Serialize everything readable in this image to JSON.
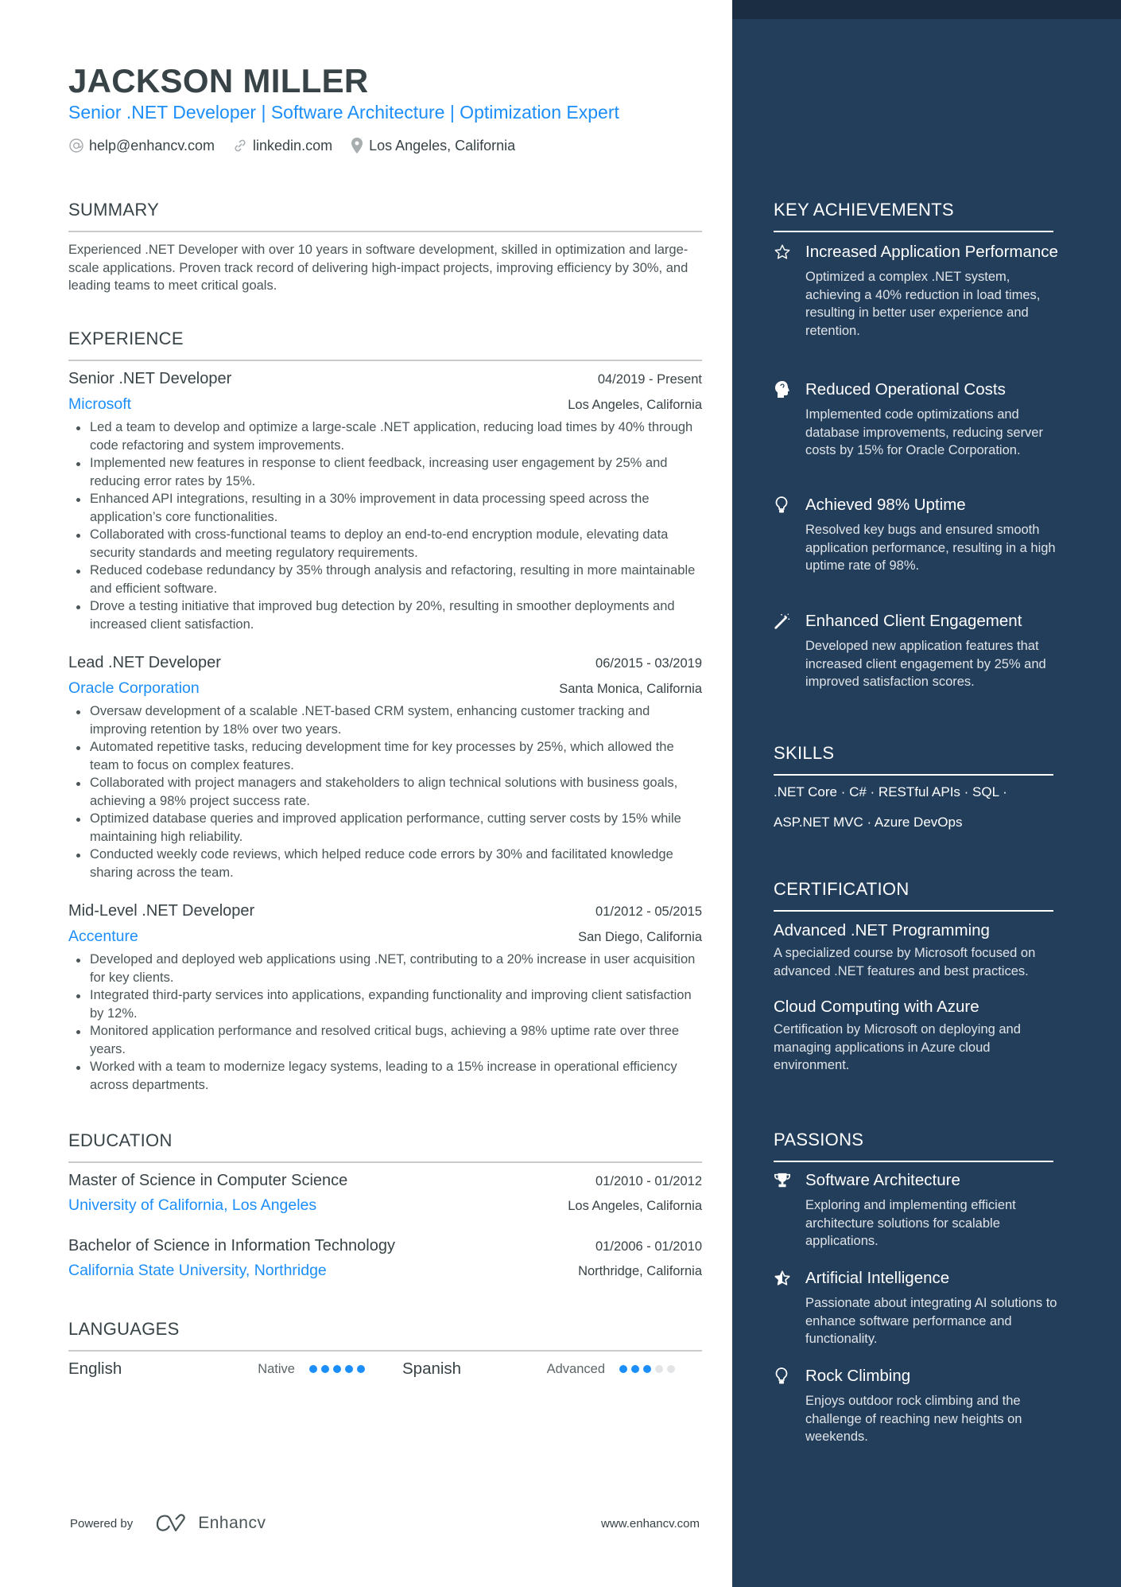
{
  "header": {
    "name": "JACKSON MILLER",
    "title": "Senior .NET Developer | Software Architecture | Optimization Expert",
    "contacts": [
      {
        "icon": "at-icon",
        "label": "help@enhancv.com"
      },
      {
        "icon": "link-icon",
        "label": "linkedin.com"
      },
      {
        "icon": "location-pin-icon",
        "label": "Los Angeles, California"
      }
    ]
  },
  "summary": {
    "heading": "SUMMARY",
    "text": "Experienced .NET Developer with over 10 years in software development, skilled in optimization and large-scale applications. Proven track record of delivering high-impact projects, improving efficiency by 30%, and leading teams to meet critical goals."
  },
  "experience": {
    "heading": "EXPERIENCE",
    "jobs": [
      {
        "role": "Senior .NET Developer",
        "dates": "04/2019 - Present",
        "company": "Microsoft",
        "location": "Los Angeles, California",
        "bullets": [
          "Led a team to develop and optimize a large-scale .NET application, reducing load times by 40% through code refactoring and system improvements.",
          "Implemented new features in response to client feedback, increasing user engagement by 25% and reducing error rates by 15%.",
          "Enhanced API integrations, resulting in a 30% improvement in data processing speed across the application’s core functionalities.",
          "Collaborated with cross-functional teams to deploy an end-to-end encryption module, elevating data security standards and meeting regulatory requirements.",
          "Reduced codebase redundancy by 35% through analysis and refactoring, resulting in more maintainable and efficient software.",
          "Drove a testing initiative that improved bug detection by 20%, resulting in smoother deployments and increased client satisfaction."
        ]
      },
      {
        "role": "Lead .NET Developer",
        "dates": "06/2015 - 03/2019",
        "company": "Oracle Corporation",
        "location": "Santa Monica, California",
        "bullets": [
          "Oversaw development of a scalable .NET-based CRM system, enhancing customer tracking and improving retention by 18% over two years.",
          "Automated repetitive tasks, reducing development time for key processes by 25%, which allowed the team to focus on complex features.",
          "Collaborated with project managers and stakeholders to align technical solutions with business goals, achieving a 98% project success rate.",
          "Optimized database queries and improved application performance, cutting server costs by 15% while maintaining high reliability.",
          "Conducted weekly code reviews, which helped reduce code errors by 30% and facilitated knowledge sharing across the team."
        ]
      },
      {
        "role": "Mid-Level .NET Developer",
        "dates": "01/2012 - 05/2015",
        "company": "Accenture",
        "location": "San Diego, California",
        "bullets": [
          "Developed and deployed web applications using .NET, contributing to a 20% increase in user acquisition for key clients.",
          "Integrated third-party services into applications, expanding functionality and improving client satisfaction by 12%.",
          "Monitored application performance and resolved critical bugs, achieving a 98% uptime rate over three years.",
          "Worked with a team to modernize legacy systems, leading to a 15% increase in operational efficiency across departments."
        ]
      }
    ]
  },
  "education": {
    "heading": "EDUCATION",
    "items": [
      {
        "degree": "Master of Science in Computer Science",
        "dates": "01/2010 - 01/2012",
        "school": "University of California, Los Angeles",
        "location": "Los Angeles, California"
      },
      {
        "degree": "Bachelor of Science in Information Technology",
        "dates": "01/2006 - 01/2010",
        "school": "California State University, Northridge",
        "location": "Northridge, California"
      }
    ]
  },
  "languages": {
    "heading": "LANGUAGES",
    "items": [
      {
        "name": "English",
        "level": "Native",
        "rating": 5,
        "max": 5
      },
      {
        "name": "Spanish",
        "level": "Advanced",
        "rating": 3,
        "max": 5
      }
    ]
  },
  "footer": {
    "powered_by": "Powered by",
    "brand": "Enhancv",
    "website": "www.enhancv.com"
  },
  "sidebar": {
    "achievements": {
      "heading": "KEY ACHIEVEMENTS",
      "items": [
        {
          "icon": "star-outline-icon",
          "title": "Increased Application Performance",
          "description": "Optimized a complex .NET system, achieving a 40% reduction in load times, resulting in better user experience and retention."
        },
        {
          "icon": "head-brain-icon",
          "title": "Reduced Operational Costs",
          "description": "Implemented code optimizations and database improvements, reducing server costs by 15% for Oracle Corporation."
        },
        {
          "icon": "lightbulb-icon",
          "title": "Achieved 98% Uptime",
          "description": "Resolved key bugs and ensured smooth application performance, resulting in a high uptime rate of 98%."
        },
        {
          "icon": "magic-wand-icon",
          "title": "Enhanced Client Engagement",
          "description": "Developed new application features that increased client engagement by 25% and improved satisfaction scores."
        }
      ]
    },
    "skills": {
      "heading": "SKILLS",
      "lines": [
        ".NET Core · C#  · RESTful APIs · SQL ·",
        "ASP.NET MVC · Azure DevOps"
      ]
    },
    "certification": {
      "heading": "CERTIFICATION",
      "items": [
        {
          "title": "Advanced .NET Programming",
          "description": "A specialized course by Microsoft focused on advanced .NET features and best practices."
        },
        {
          "title": "Cloud Computing with Azure",
          "description": "Certification by Microsoft on deploying and managing applications in Azure cloud environment."
        }
      ]
    },
    "passions": {
      "heading": "PASSIONS",
      "items": [
        {
          "icon": "trophy-icon",
          "title": "Software Architecture",
          "description": "Exploring and implementing efficient architecture solutions for scalable applications."
        },
        {
          "icon": "star-half-icon",
          "title": "Artificial Intelligence",
          "description": "Passionate about integrating AI solutions to enhance software performance and functionality."
        },
        {
          "icon": "lightbulb-icon",
          "title": "Rock Climbing",
          "description": "Enjoys outdoor rock climbing and the challenge of reaching new heights on weekends."
        }
      ]
    }
  },
  "colors": {
    "accent": "#1c8ef9",
    "sidebar_bg": "#233e5b",
    "sidebar_top": "#1b2d43",
    "text": "#384347",
    "dot_empty": "#e2e4e6"
  }
}
